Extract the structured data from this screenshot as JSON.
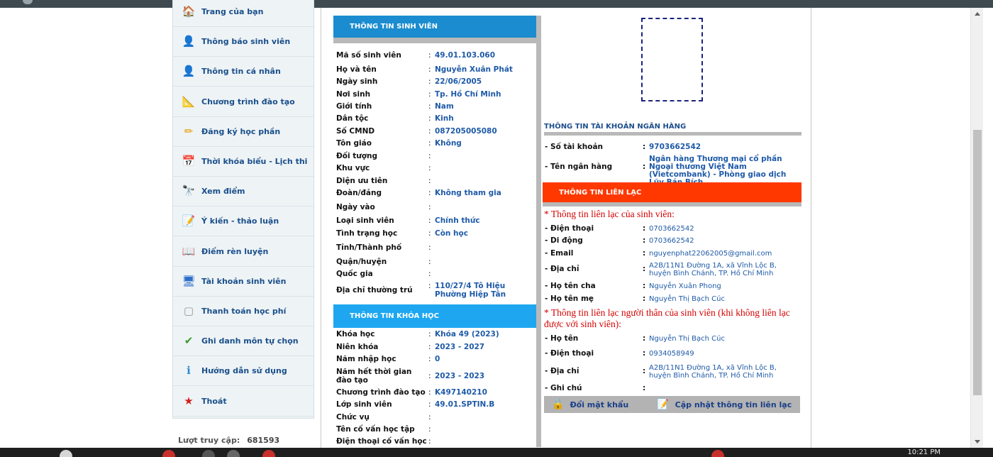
{
  "sidebar": {
    "items": [
      {
        "label": "Trang của bạn",
        "icon": "home-icon",
        "glyph": "🏠"
      },
      {
        "label": "Thông báo sinh viên",
        "icon": "user-icon",
        "glyph": "👤"
      },
      {
        "label": "Thông tin cá nhân",
        "icon": "user-icon",
        "glyph": "👤"
      },
      {
        "label": "Chương trình đào tạo",
        "icon": "compass-icon",
        "glyph": "📐"
      },
      {
        "label": "Đăng ký học phần",
        "icon": "pencil-icon",
        "glyph": "✏"
      },
      {
        "label": "Thời khóa biểu - Lịch thi",
        "icon": "calendar-icon",
        "glyph": "📅"
      },
      {
        "label": "Xem điểm",
        "icon": "binoculars-icon",
        "glyph": "🔭"
      },
      {
        "label": "Ý kiến - thảo luận",
        "icon": "notepad-icon",
        "glyph": "📝"
      },
      {
        "label": "Điểm rèn luyện",
        "icon": "book-icon",
        "glyph": "📖"
      },
      {
        "label": "Tài khoản sinh viên",
        "icon": "monitor-icon",
        "glyph": "🖥"
      },
      {
        "label": "Thanh toán học phí",
        "icon": "broken-image-icon",
        "glyph": "▢"
      },
      {
        "label": "Ghi danh môn tự chọn",
        "icon": "checkmark-icon",
        "glyph": "✔"
      },
      {
        "label": "Hướng dẫn sử dụng",
        "icon": "info-icon",
        "glyph": "ℹ"
      },
      {
        "label": "Thoát",
        "icon": "star-icon",
        "glyph": "★"
      }
    ],
    "visits_label": "Lượt truy cập:",
    "visits_count": "681593"
  },
  "student": {
    "title": "THÔNG TIN SINH VIÊN",
    "fields": [
      {
        "label": "Mã số sinh viên",
        "value": "49.01.103.060"
      },
      {
        "label": "Họ và tên",
        "value": "Nguyễn Xuân Phát"
      },
      {
        "label": "Ngày sinh",
        "value": "22/06/2005"
      },
      {
        "label": "Nơi sinh",
        "value": "Tp. Hồ Chí Minh"
      },
      {
        "label": "Giới tính",
        "value": "Nam"
      },
      {
        "label": "Dân tộc",
        "value": "Kinh"
      },
      {
        "label": "Số CMND",
        "value": "087205005080"
      },
      {
        "label": "Tôn giáo",
        "value": "Không"
      },
      {
        "label": "Đối tượng",
        "value": ""
      },
      {
        "label": "Khu vực",
        "value": ""
      },
      {
        "label": "Diện ưu tiên",
        "value": ""
      },
      {
        "label": "Đoàn/đảng",
        "value": "Không tham gia"
      },
      {
        "label": "Ngày vào",
        "value": ""
      },
      {
        "label": "Loại sinh viên",
        "value": "Chính thức"
      },
      {
        "label": "Tình trạng học",
        "value": "Còn học"
      },
      {
        "label": "Tỉnh/Thành phố",
        "value": ""
      },
      {
        "label": "Quận/huyện",
        "value": ""
      },
      {
        "label": "Quốc gia",
        "value": ""
      },
      {
        "label": "Địa chỉ thường trú",
        "value": "110/27/4 Tô Hiệu Phường Hiệp Tân"
      }
    ]
  },
  "course": {
    "title": "THÔNG TIN KHÓA HỌC",
    "fields": [
      {
        "label": "Khóa học",
        "value": "Khóa 49 (2023)"
      },
      {
        "label": "Niên khóa",
        "value": "2023 - 2027"
      },
      {
        "label": "Năm nhập học",
        "value": "0"
      },
      {
        "label": "Năm hết thời gian đào tạo",
        "value": "2023 - 2023"
      },
      {
        "label": "Chương trình đào tạo",
        "value": "K497140210"
      },
      {
        "label": "Lớp sinh viên",
        "value": "49.01.SPTIN.B"
      },
      {
        "label": "Chức vụ",
        "value": ""
      },
      {
        "label": "Tên cố vấn học tập",
        "value": ""
      },
      {
        "label": "Điện thoại cố vấn học",
        "value": ""
      }
    ]
  },
  "bank": {
    "title": "THÔNG TIN TÀI KHOẢN NGÂN HÀNG",
    "account_label": "- Số tài khoản",
    "account_value": "9703662542",
    "bank_label": "- Tên ngân hàng",
    "bank_value": "Ngân hàng Thương mại cổ phần Ngoại thương Việt Nam (Vietcombank) - Phòng giao dịch Lũy Bán Bích"
  },
  "contact": {
    "title": "THÔNG TIN LIÊN LẠC",
    "student_note": "* Thông tin liên lạc của sinh viên:",
    "student_fields": [
      {
        "label": "- Điện thoại",
        "value": "0703662542"
      },
      {
        "label": "- Di động",
        "value": "0703662542"
      },
      {
        "label": "- Email",
        "value": "nguyenphat22062005@gmail.com"
      },
      {
        "label": "- Địa chỉ",
        "value": "A2B/11N1 Đường 1A, xã Vĩnh Lộc B, huyện Bình Chánh, TP. Hồ Chí Minh"
      },
      {
        "label": "- Họ tên cha",
        "value": "Nguyễn Xuân Phong"
      },
      {
        "label": "- Họ tên mẹ",
        "value": "Nguyễn Thị Bạch Cúc"
      }
    ],
    "relative_note": "* Thông tin liên lạc người thân của sinh viên (khi không liên lạc được với sinh viên):",
    "relative_fields": [
      {
        "label": "- Họ tên",
        "value": "Nguyễn Thị Bạch Cúc"
      },
      {
        "label": "- Điện thoại",
        "value": "0934058949"
      },
      {
        "label": "- Địa chỉ",
        "value": "A2B/11N1 Đường 1A, xã Vĩnh Lộc B, huyện Bình Chánh, TP. Hồ Chí Minh"
      },
      {
        "label": "- Ghi chú",
        "value": ""
      }
    ]
  },
  "actions": {
    "change_password": "Đổi mật khẩu",
    "update_contact": "Cập nhật thông tin liên lạc"
  },
  "taskbar": {
    "time": "10:21 PM"
  },
  "colors": {
    "student_header": "#1a8ccf",
    "course_header": "#1ea7f0",
    "contact_header": "#ff3800",
    "link_blue": "#1e5aa8",
    "note_red": "#d40000"
  }
}
